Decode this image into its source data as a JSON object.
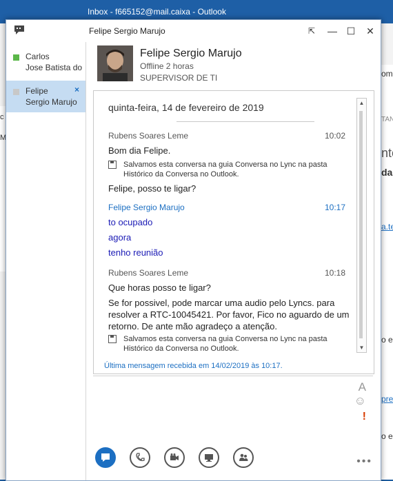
{
  "outlook": {
    "title": "Inbox - f665152@mail.caixa - Outlook",
    "bg_texts": [
      "omp",
      "TAN",
      "nto",
      "da",
      "a.te",
      "o e",
      "pres",
      "o e",
      "M",
      "c"
    ]
  },
  "window": {
    "title": "Felipe Sergio Marujo",
    "restore_glyph": "⇱",
    "minimize_glyph": "—",
    "maximize_glyph": "☐",
    "close_glyph": "✕"
  },
  "conversations": [
    {
      "line1": "Carlos",
      "line2": "Jose Batista do",
      "presence_color": "#5bb749"
    },
    {
      "line1": "Felipe",
      "line2": "Sergio Marujo",
      "presence_color": "#c8c8c8",
      "close": "×"
    }
  ],
  "contact": {
    "name": "Felipe Sergio Marujo",
    "status": "Offline 2 horas",
    "title": "SUPERVISOR DE TI"
  },
  "history": {
    "date": "quinta-feira, 14 de fevereiro de 2019",
    "blocks": [
      {
        "sender": "Rubens Soares Leme",
        "time": "10:02"
      },
      {
        "sender": "Felipe Sergio Marujo",
        "time": "10:17"
      },
      {
        "sender": "Rubens Soares Leme",
        "time": "10:18"
      }
    ],
    "messages": {
      "m1": "Bom dia Felipe.",
      "saved": "Salvamos esta conversa na guia Conversa no Lync na pasta Histórico da Conversa no Outlook.",
      "m2": "Felipe, posso te ligar?",
      "m3": "to ocupado",
      "m4": "agora",
      "m5": "tenho reunião",
      "m6": "Que horas posso te ligar?",
      "m7": "Se for possivel, pode marcar uma audio pelo Lyncs. para resolver a RTC-10045421. Por favor, Fico no aguardo de um retorno.  De ante mão agradeço a atenção.",
      "saved2": "Salvamos esta conversa na guia Conversa no Lync na pasta Histórico da Conversa no Outlook."
    },
    "last_message": "Última mensagem recebida em 14/02/2019 às 10:17."
  },
  "compose": {
    "font_glyph": "A",
    "emoji_glyph": "☺",
    "urgent_glyph": "!"
  },
  "toolbar": {
    "more_glyph": "•••"
  }
}
